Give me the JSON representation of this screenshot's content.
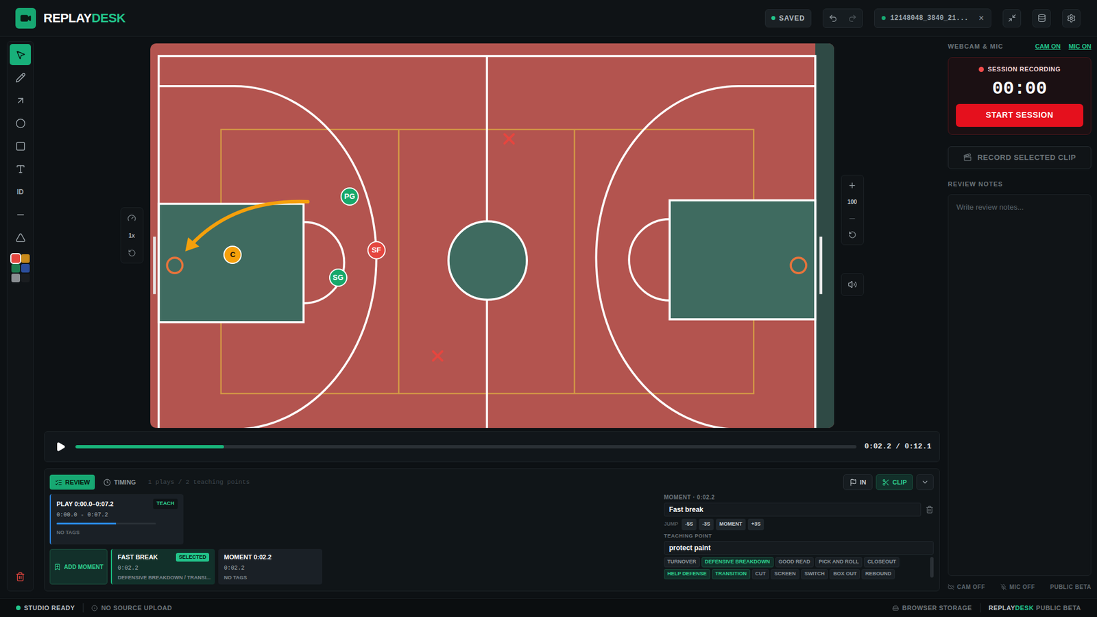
{
  "brand": {
    "primary": "REPLAY",
    "accent": "DESK"
  },
  "header": {
    "status": "SAVED",
    "file": {
      "name": "12148048_3840_21...",
      "close": "×"
    }
  },
  "tools": [
    {
      "kind": "pointer",
      "selected": true
    },
    {
      "kind": "pen",
      "selected": false
    },
    {
      "kind": "arrow",
      "selected": false
    },
    {
      "kind": "circle",
      "selected": false
    },
    {
      "kind": "rectangle",
      "selected": false
    },
    {
      "kind": "text",
      "selected": false
    },
    {
      "kind": "id",
      "label": "ID",
      "selected": false
    },
    {
      "kind": "line",
      "selected": false
    },
    {
      "kind": "triangle",
      "selected": false
    }
  ],
  "swatches": [
    {
      "color": "#e5463f",
      "selected": true
    },
    {
      "color": "#c98a1a",
      "selected": false
    },
    {
      "color": "#1f7a4f",
      "selected": false
    },
    {
      "color": "#2b4d9a",
      "selected": false
    },
    {
      "color": "#8a8f93",
      "selected": false
    },
    {
      "color": "#1a1d20",
      "selected": false
    }
  ],
  "speed_control": {
    "speed": "1x"
  },
  "zoom_control": {
    "zoom": "100"
  },
  "video": {
    "players": [
      {
        "label": "PG",
        "color": "#17a86a",
        "text_color": "#ffffff"
      },
      {
        "label": "SG",
        "color": "#17a86a",
        "text_color": "#ffffff"
      },
      {
        "label": "SF",
        "color": "#e5463f",
        "text_color": "#ffffff"
      },
      {
        "label": "C",
        "color": "#f5a00b",
        "text_color": "#1a1205"
      }
    ],
    "marks": [
      {
        "color": "#e5463f"
      },
      {
        "color": "#e5463f"
      }
    ],
    "arrow": {
      "color": "#f5a00b"
    }
  },
  "timeline": {
    "playing": false,
    "level": 0.19,
    "time": "0:02.2 / 0:12.1"
  },
  "review": {
    "tabs": [
      {
        "label": "REVIEW",
        "selected": true
      },
      {
        "label": "TIMING",
        "selected": false
      }
    ],
    "summary": "1 plays / 2 teaching points",
    "actions": [
      {
        "label": "IN",
        "selected": false
      },
      {
        "label": "CLIP",
        "selected": true
      }
    ]
  },
  "plays": [
    {
      "title": "PLAY 0:00.0–0:07.2",
      "badge": "TEACH",
      "range": "0:00.0 - 0:07.2",
      "level": 0.6,
      "tags": "NO TAGS"
    }
  ],
  "add_moment": "ADD MOMENT",
  "moments": [
    {
      "title": "FAST BREAK",
      "badge": "SELECTED",
      "time": "0:02.2",
      "tags": "DEFENSIVE BREAKDOWN / TRANSI...",
      "selected": true
    },
    {
      "title": "MOMENT 0:02.2",
      "time": "0:02.2",
      "tags": "NO TAGS",
      "selected": false
    }
  ],
  "editor": {
    "heading": "MOMENT · 0:02.2",
    "title_value": "Fast break",
    "jump_label": "JUMP",
    "jumps": [
      "-5S",
      "-3S",
      "MOMENT",
      "+3S"
    ],
    "teaching_label": "TEACHING POINT",
    "teaching_value": "protect paint",
    "tags": [
      {
        "label": "TURNOVER",
        "selected": false
      },
      {
        "label": "DEFENSIVE BREAKDOWN",
        "selected": true
      },
      {
        "label": "GOOD READ",
        "selected": false
      },
      {
        "label": "PICK AND ROLL",
        "selected": false
      },
      {
        "label": "CLOSEOUT",
        "selected": false
      },
      {
        "label": "HELP DEFENSE",
        "selected": true
      },
      {
        "label": "TRANSITION",
        "selected": true
      },
      {
        "label": "CUT",
        "selected": false
      },
      {
        "label": "SCREEN",
        "selected": false
      },
      {
        "label": "SWITCH",
        "selected": false
      },
      {
        "label": "BOX OUT",
        "selected": false
      },
      {
        "label": "REBOUND",
        "selected": false
      }
    ]
  },
  "sidebar": {
    "heading": "WEBCAM & MIC",
    "toggles": [
      {
        "label": "CAM ON"
      },
      {
        "label": "MIC ON"
      }
    ],
    "recording": {
      "label": "SESSION RECORDING",
      "timer": "00:00",
      "button": "START SESSION"
    },
    "record_clip": {
      "label": "RECORD SELECTED CLIP",
      "disabled": true
    },
    "notes": {
      "label": "REVIEW NOTES",
      "placeholder": "Write review notes..."
    },
    "footer": [
      "CAM OFF",
      "MIC OFF",
      "PUBLIC BETA"
    ]
  },
  "status_bar": {
    "left": [
      "STUDIO READY",
      "NO SOURCE UPLOAD"
    ],
    "right": [
      "BROWSER STORAGE"
    ],
    "brand": {
      "primary": "REPLAY",
      "accent": "DESK",
      "suffix": "PUBLIC BETA"
    }
  }
}
